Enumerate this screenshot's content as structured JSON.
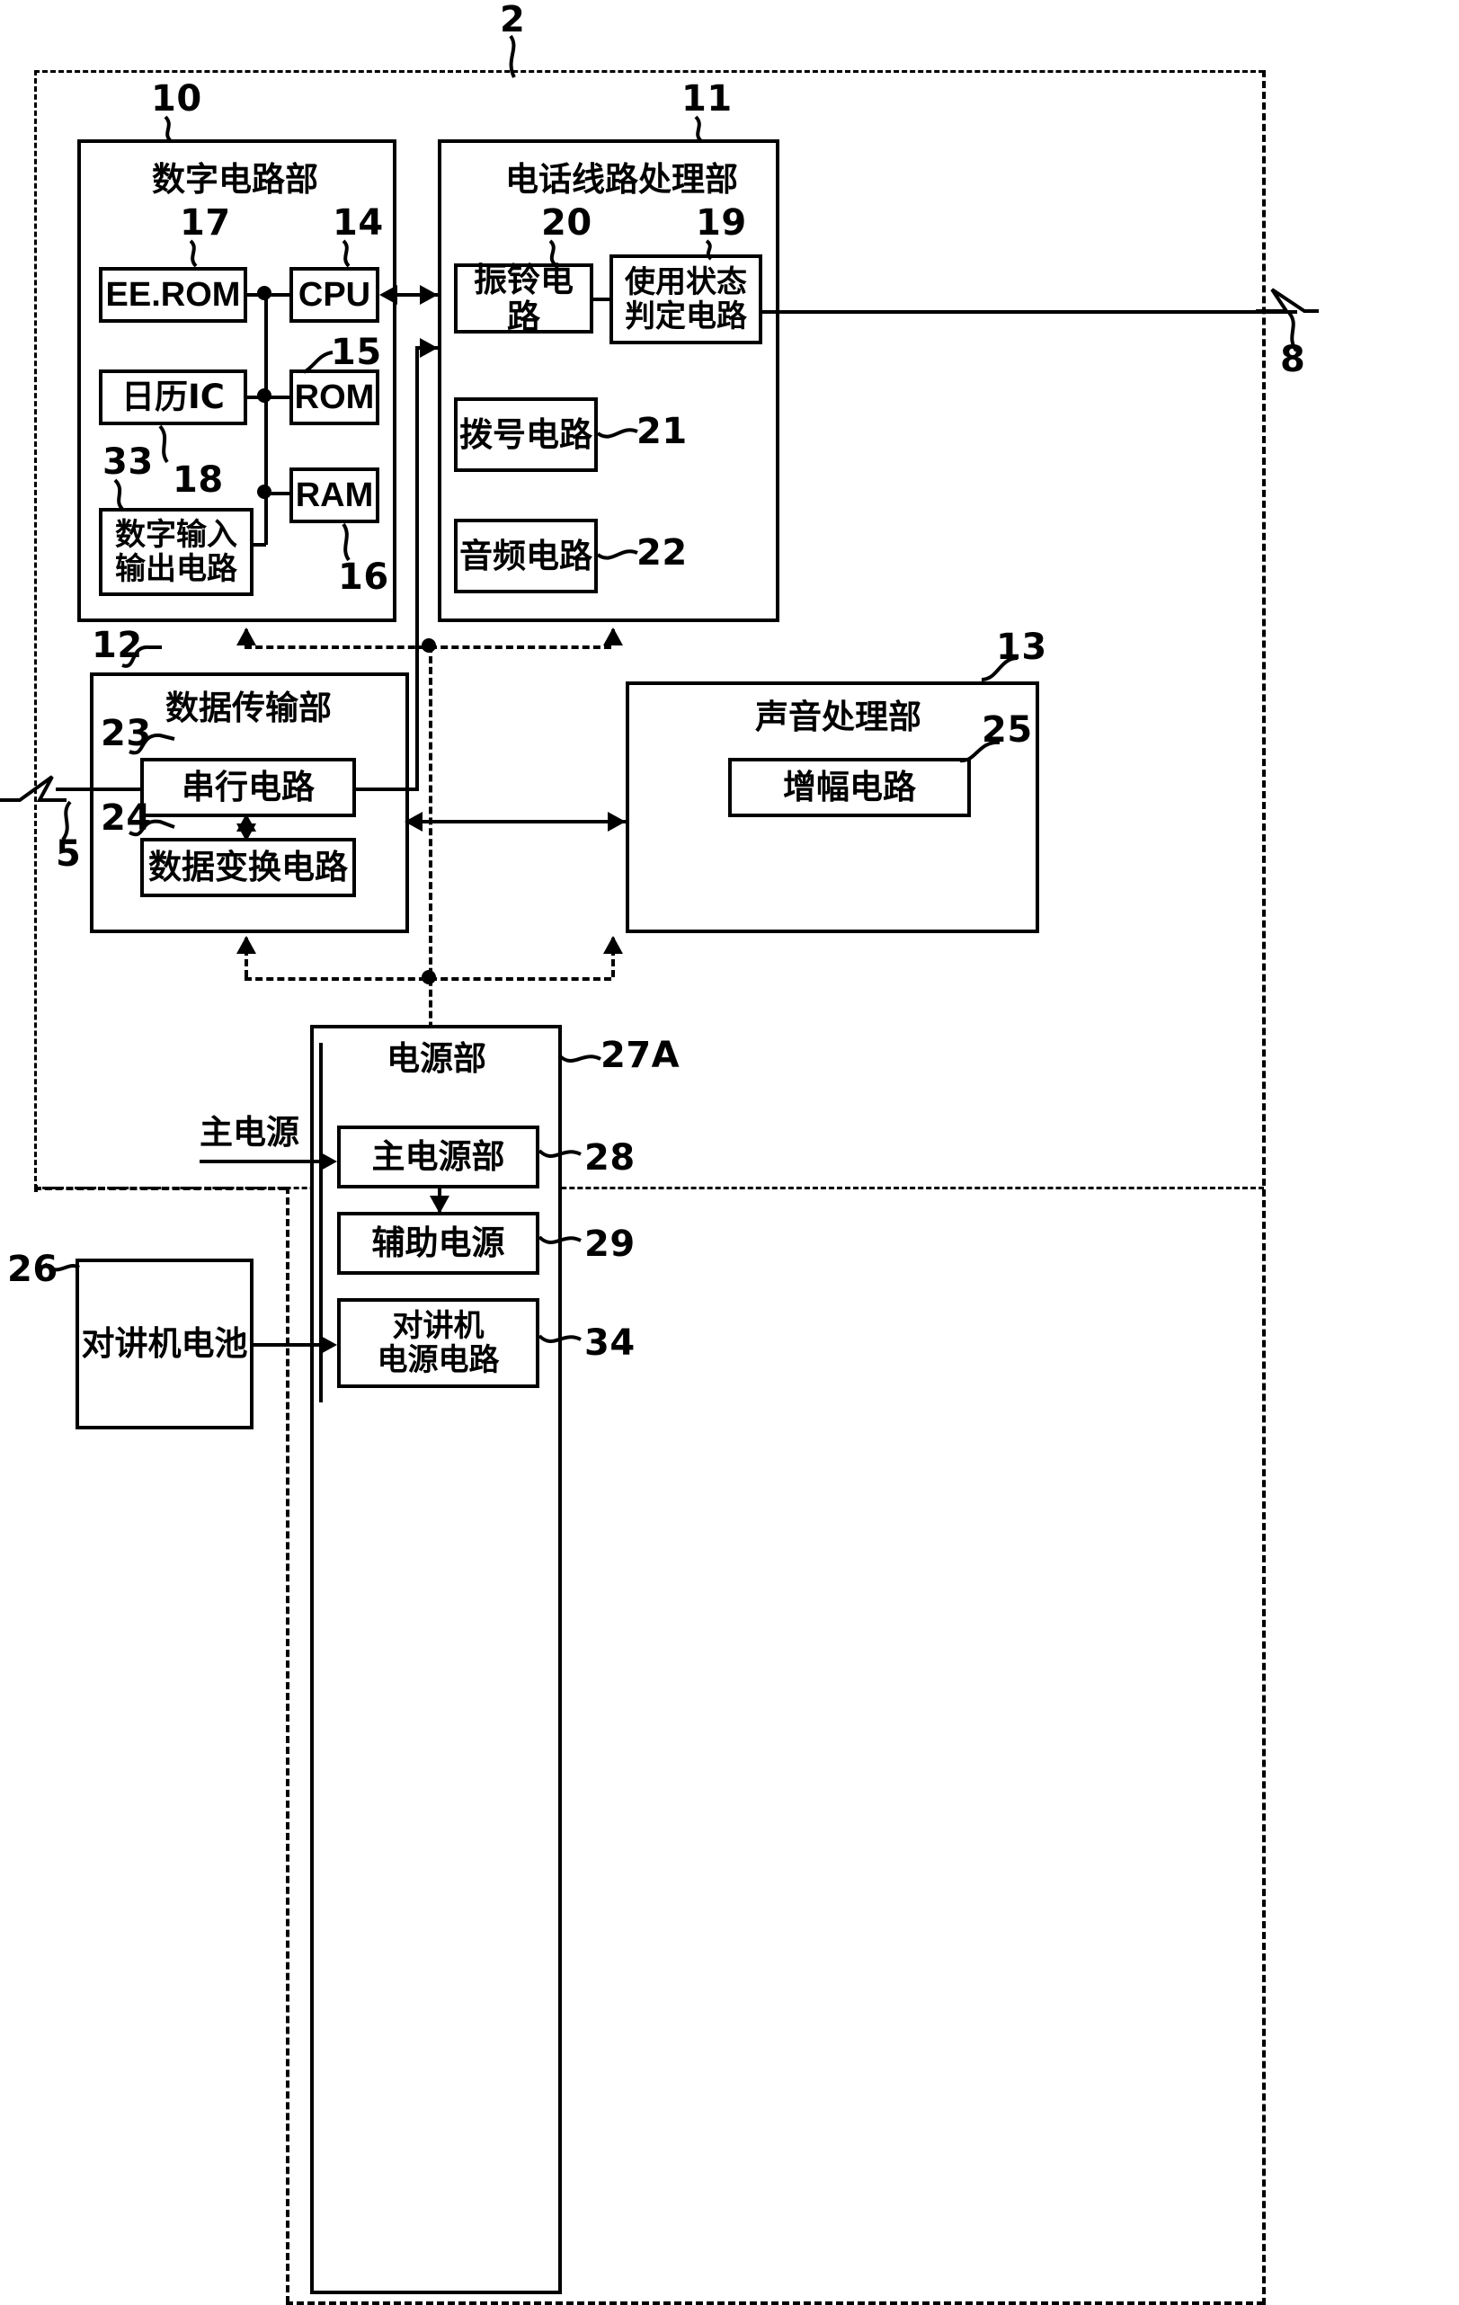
{
  "diagram": {
    "type": "block-diagram",
    "outer_ref": "2",
    "external_refs": {
      "line8": "8",
      "line5": "5",
      "battery_ref": "26"
    },
    "groups": [
      {
        "ref": "10",
        "title": "数字电路部"
      },
      {
        "ref": "11",
        "title": "电话线路处理部"
      },
      {
        "ref": "12",
        "title": "数据传输部"
      },
      {
        "ref": "13",
        "title": "声音处理部"
      },
      {
        "ref": "27A",
        "title": "电源部"
      }
    ],
    "blocks": {
      "eerom": {
        "ref": "17",
        "label": "EE.ROM"
      },
      "cpu": {
        "ref": "14",
        "label": "CPU"
      },
      "calic": {
        "ref": "18",
        "label": "日历IC"
      },
      "rom": {
        "ref": "15",
        "label": "ROM"
      },
      "ram": {
        "ref": "16",
        "label": "RAM"
      },
      "dio": {
        "ref": "33",
        "label_l1": "数字输入",
        "label_l2": "输出电路"
      },
      "ring": {
        "ref": "20",
        "label": "振铃电路"
      },
      "usage": {
        "ref": "19",
        "label_l1": "使用状态",
        "label_l2": "判定电路"
      },
      "dial": {
        "ref": "21",
        "label": "拨号电路"
      },
      "audio": {
        "ref": "22",
        "label": "音频电路"
      },
      "serial": {
        "ref": "23",
        "label": "串行电路"
      },
      "convert": {
        "ref": "24",
        "label": "数据变换电路"
      },
      "amp": {
        "ref": "25",
        "label": "增幅电路"
      },
      "mainpsu": {
        "ref": "28",
        "label": "主电源部"
      },
      "auxpsu": {
        "ref": "29",
        "label": "辅助电源"
      },
      "icpsu": {
        "ref": "34",
        "label_l1": "对讲机",
        "label_l2": "电源电路"
      },
      "battery": {
        "ref": "26",
        "label": "对讲机电池"
      }
    },
    "annotations": {
      "main_power_input": "主电源"
    }
  }
}
